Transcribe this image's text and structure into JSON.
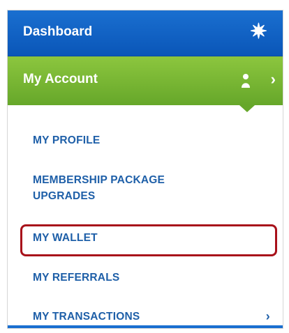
{
  "dashboard": {
    "label": "Dashboard",
    "icon": "gear-star-icon"
  },
  "account": {
    "label": "My Account",
    "icon": "person-icon",
    "chevron": "›"
  },
  "menu": {
    "items": [
      {
        "label": "MY PROFILE"
      },
      {
        "label_line1": "MEMBERSHIP PACKAGE",
        "label_line2": "UPGRADES"
      },
      {
        "label": "MY WALLET",
        "highlighted": true
      },
      {
        "label": "MY REFERRALS"
      },
      {
        "label": "MY TRANSACTIONS",
        "chevron": "›"
      }
    ]
  },
  "colors": {
    "dashboard_bar": "#0a56b8",
    "account_bar": "#66a72a",
    "menu_text": "#1e5fa8",
    "highlight_border": "#a8111a"
  }
}
